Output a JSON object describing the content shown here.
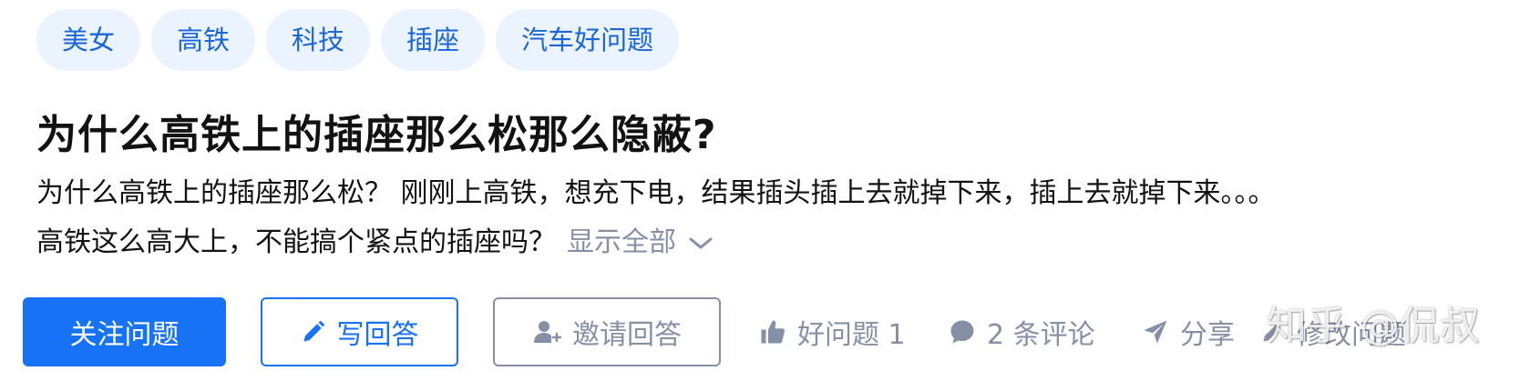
{
  "topics": [
    "美女",
    "高铁",
    "科技",
    "插座",
    "汽车好问题"
  ],
  "question": {
    "title": "为什么高铁上的插座那么松那么隐蔽?",
    "description_line1": "为什么高铁上的插座那么松？ 刚刚上高铁，想充下电，结果插头插上去就掉下来，插上去就掉下来。。。",
    "description_line2": "高铁这么高大上，不能搞个紧点的插座吗？",
    "show_all": "显示全部"
  },
  "actions": {
    "follow": "关注问题",
    "write_answer": "写回答",
    "invite": "邀请回答",
    "good_question": "好问题 1",
    "comments": "2 条评论",
    "share": "分享",
    "edit": "修改问题"
  },
  "watermark": "知乎 @侃叔",
  "colors": {
    "brand_blue": "#1772f6",
    "topic_bg": "#ebf3fe",
    "topic_text": "#1a66d9",
    "muted": "#8590a6",
    "text": "#121212"
  },
  "icons": [
    "pencil-icon",
    "invite-user-icon",
    "thumbs-up-icon",
    "comment-icon",
    "share-icon",
    "edit-icon",
    "chevron-down-icon"
  ]
}
